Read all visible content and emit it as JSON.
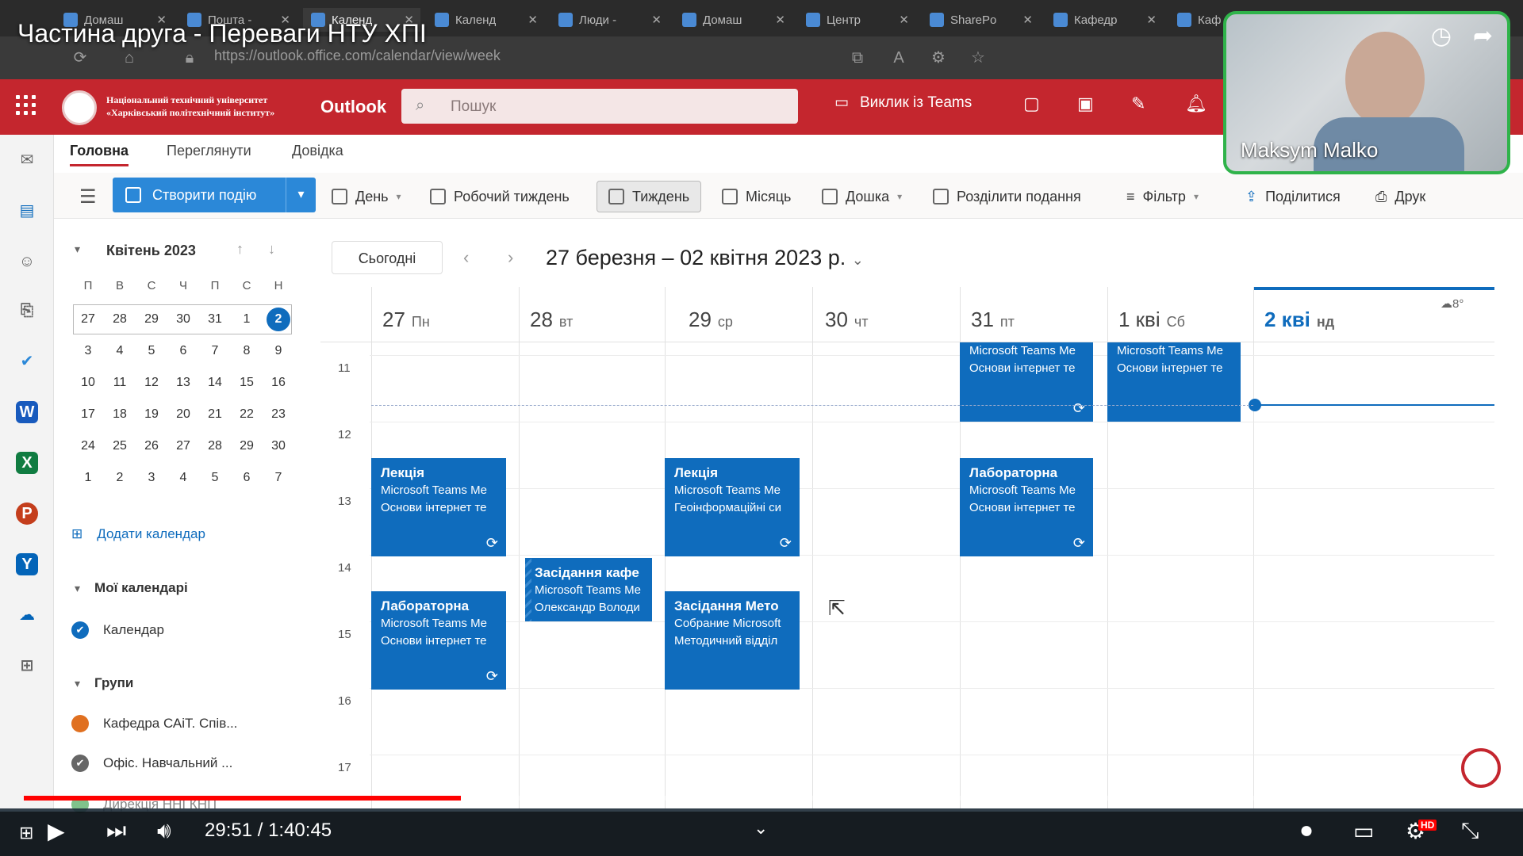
{
  "video": {
    "title": "Частина друга - Переваги НТУ ХПІ",
    "time_current": "29:51",
    "time_total": "1:40:45",
    "time_display": "29:51 / 1:40:45",
    "progress": 0.296,
    "hd_badge": "HD",
    "presenter_name": "Maksym Malko"
  },
  "browser": {
    "tabs": [
      "Домаш",
      "Пошта -",
      "Календ",
      "Календ",
      "Люди -",
      "Домаш",
      "Центр",
      "SharePo",
      "Кафедр",
      "Каф"
    ],
    "url": "https://outlook.office.com/calendar/view/week"
  },
  "header": {
    "university_name": "Національний технічний університет «Харківський політехнічний інститут»",
    "app_name": "Outlook",
    "search_placeholder": "Пошук",
    "teams_call": "Виклик із Teams"
  },
  "menu_tabs": [
    "Головна",
    "Переглянути",
    "Довідка"
  ],
  "ribbon": {
    "new_event": "Створити подію",
    "day": "День",
    "work_week": "Робочий тиждень",
    "week": "Тиждень",
    "month": "Місяць",
    "board": "Дошка",
    "split_view": "Розділити подання",
    "filter": "Фільтр",
    "share": "Поділитися",
    "print": "Друк"
  },
  "mini_calendar": {
    "title": "Квітень 2023",
    "weekdays": [
      "П",
      "В",
      "С",
      "Ч",
      "П",
      "С",
      "Н"
    ],
    "weeks": [
      [
        "27",
        "28",
        "29",
        "30",
        "31",
        "1",
        "2"
      ],
      [
        "3",
        "4",
        "5",
        "6",
        "7",
        "8",
        "9"
      ],
      [
        "10",
        "11",
        "12",
        "13",
        "14",
        "15",
        "16"
      ],
      [
        "17",
        "18",
        "19",
        "20",
        "21",
        "22",
        "23"
      ],
      [
        "24",
        "25",
        "26",
        "27",
        "28",
        "29",
        "30"
      ],
      [
        "1",
        "2",
        "3",
        "4",
        "5",
        "6",
        "7"
      ]
    ],
    "today": "2"
  },
  "pane": {
    "add_calendar": "Додати календар",
    "my_calendars": "Мої календарі",
    "calendar": "Календар",
    "groups": "Групи",
    "group_items": [
      "Кафедра САіТ. Спів...",
      "Офіс. Навчальний ...",
      "Дирекція ННІ КНІТ"
    ]
  },
  "calendar": {
    "today_button": "Сьогодні",
    "date_range": "27 березня – 02 квітня 2023 р.",
    "weather": "8°",
    "days": [
      {
        "num": "27",
        "name": "Пн"
      },
      {
        "num": "28",
        "name": "вт"
      },
      {
        "num": "29",
        "name": "ср"
      },
      {
        "num": "30",
        "name": "чт"
      },
      {
        "num": "31",
        "name": "пт"
      },
      {
        "num": "1 кві",
        "name": "Сб"
      },
      {
        "num": "2 кві",
        "name": "нд"
      }
    ],
    "hours": [
      "11",
      "12",
      "13",
      "14",
      "15",
      "16",
      "17"
    ],
    "events": {
      "top_fri": {
        "line1": "Microsoft Teams Me",
        "line2": "Основи інтернет те"
      },
      "top_sat": {
        "line1": "Microsoft Teams Me",
        "line2": "Основи інтернет те"
      },
      "mon_1": {
        "title": "Лекція",
        "line1": "Microsoft Teams Me",
        "line2": "Основи інтернет те"
      },
      "wed_1": {
        "title": "Лекція",
        "line1": "Microsoft Teams Me",
        "line2": "Геоінформаційні си"
      },
      "fri_1": {
        "title": "Лабораторна",
        "line1": "Microsoft Teams Me",
        "line2": "Основи інтернет те"
      },
      "tue_1": {
        "title": "Засідання кафе",
        "line1": "Microsoft Teams Me",
        "line2": "Олександр Володи"
      },
      "mon_2": {
        "title": "Лабораторна",
        "line1": "Microsoft Teams Me",
        "line2": "Основи інтернет те"
      },
      "wed_2": {
        "title": "Засідання Мето",
        "line1": "Собрание Microsoft",
        "line2": "Методичний відділ"
      }
    }
  },
  "colors": {
    "brand": "#c4262e",
    "accent": "#0f6cbd",
    "event": "#0f6cbd",
    "cam_border": "#2fb34a"
  }
}
